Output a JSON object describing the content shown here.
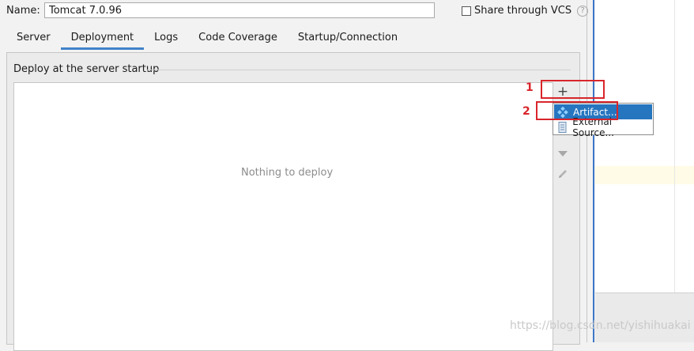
{
  "form": {
    "name_label": "Name:",
    "name_value": "Tomcat 7.0.96",
    "share_vcs_label": "Share through VCS",
    "help_glyph": "?"
  },
  "tabs": [
    {
      "label": "Server"
    },
    {
      "label": "Deployment",
      "active": true
    },
    {
      "label": "Logs"
    },
    {
      "label": "Code Coverage"
    },
    {
      "label": "Startup/Connection"
    }
  ],
  "deploy": {
    "group_title": "Deploy at the server startup",
    "empty_text": "Nothing to deploy",
    "add_glyph": "+"
  },
  "popup_menu": {
    "items": [
      {
        "label": "Artifact...",
        "icon": "artifact-icon",
        "selected": true
      },
      {
        "label": "External Source...",
        "icon": "external-source-icon"
      }
    ]
  },
  "annotations": {
    "step1": "1",
    "step2": "2",
    "color": "#d9252b"
  },
  "watermark": "https://blog.csdn.net/yishihuakai",
  "colors": {
    "accent": "#2675bf",
    "tab_underline": "#4083c9",
    "side_line": "#3d76c9"
  }
}
